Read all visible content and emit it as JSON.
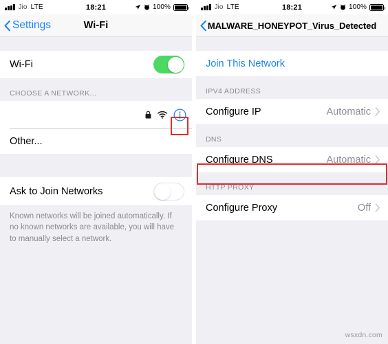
{
  "colors": {
    "accent_blue": "#1b85f3",
    "toggle_on_green": "#4cd864",
    "highlight_red": "#e02d2d",
    "group_background": "#efeff4",
    "row_background": "#ffffff",
    "secondary_text": "#8e8e93"
  },
  "status_bar": {
    "carrier": "Jio",
    "network_type": "LTE",
    "time": "18:21",
    "battery_percent": "100%",
    "icons": [
      "signal-bars-icon",
      "location-arrow-icon",
      "alarm-clock-icon",
      "battery-icon"
    ]
  },
  "left_panel": {
    "nav": {
      "back_label": "Settings",
      "title": "Wi-Fi"
    },
    "wifi_toggle_row": {
      "label": "Wi-Fi",
      "state": "on"
    },
    "choose_network_header": "CHOOSE A NETWORK...",
    "network_row": {
      "name": "",
      "icons": [
        "lock-icon",
        "wifi-icon",
        "info-icon"
      ],
      "highlighted": true
    },
    "other_row": {
      "label": "Other..."
    },
    "ask_to_join_row": {
      "label": "Ask to Join Networks",
      "state": "off"
    },
    "footer_note": "Known networks will be joined automatically. If no known networks are available, you will have to manually select a network."
  },
  "right_panel": {
    "nav": {
      "back_label": "",
      "title": "MALWARE_HONEYPOT_Virus_Detected"
    },
    "join_network_row": {
      "label": "Join This Network"
    },
    "ipv4_section": {
      "header": "IPV4 ADDRESS",
      "rows": [
        {
          "label": "Configure IP",
          "value": "Automatic"
        }
      ]
    },
    "dns_section": {
      "header": "DNS",
      "rows": [
        {
          "label": "Configure DNS",
          "value": "Automatic",
          "highlighted": true
        }
      ]
    },
    "proxy_section": {
      "header": "HTTP PROXY",
      "rows": [
        {
          "label": "Configure Proxy",
          "value": "Off"
        }
      ]
    }
  },
  "watermark": "wsxdn.com"
}
